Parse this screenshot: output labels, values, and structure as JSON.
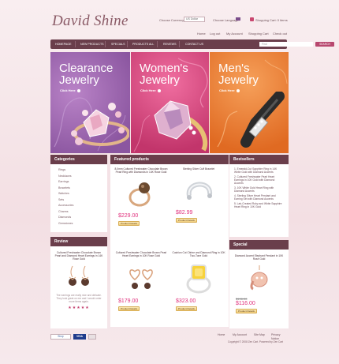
{
  "brand": {
    "logo": "David Shine"
  },
  "header": {
    "currency_label": "Choose Currency:",
    "currency_value": "US Dollar",
    "language_label": "Choose Language:",
    "cart_label": "Shopping Cart: 0 items",
    "links": [
      "Home",
      "Log out",
      "My Account",
      "Shopping Cart",
      "Check out"
    ]
  },
  "nav": {
    "items": [
      "HOMEPAGE",
      "NEW PRODUCTS",
      "SPECIALS",
      "PRODUCTS ALL",
      "REVIEWS",
      "CONTACT US"
    ],
    "search_placeholder": "Find",
    "search_button": "SEARCH"
  },
  "banners": [
    {
      "line1": "Clearance",
      "line2": "Jewelry",
      "more": "Click Here"
    },
    {
      "line1": "Women's",
      "line2": "Jewelry",
      "more": "Click Here"
    },
    {
      "line1": "Men's",
      "line2": "Jewelry",
      "more": "Click Here"
    }
  ],
  "categories": {
    "title": "Categories",
    "items": [
      "Rings",
      "Necklaces",
      "Earrings",
      "Bracelets",
      "Watches",
      "Sets",
      "Accessories",
      "Charms",
      "Diamonds",
      "Gemstones"
    ]
  },
  "review": {
    "title": "Review",
    "product": "Cultured Freshwater Chocolate Brown Pearl and Diamond Heart Earrings in 14K Rose Gold",
    "text": "The earrings are really nice and delicate. They look great on me and I would order more items again."
  },
  "featured": {
    "title": "Featured products",
    "products": [
      {
        "name": "8.0mm Cultured Freshwater Chocolate Brown Pearl Ring with Diamonds in 14K Rose Gold",
        "price": "$229.00",
        "button": "Product Details"
      },
      {
        "name": "Sterling Silver Cuff Bracelet",
        "price": "$82.99",
        "button": "Product Details"
      },
      {
        "name": "Cultured Freshwater Chocolate Brown Pearl Heart Earrings in 10K Rose Gold",
        "price": "$179.00",
        "button": "Product Details"
      },
      {
        "name": "Cushion Cut Citrine and Diamond Ring in 10K Two-Tone Gold",
        "price": "$323.00",
        "button": "Product Details"
      }
    ]
  },
  "bestsellers": {
    "title": "Bestsellers",
    "items": [
      "1. Emerald-Cut Sapphire Ring in 14K White Gold with Diamond Accents",
      "2. Cultured Freshwater Pearl Heart Earrings in 10K Gold with Diamond Accents",
      "3. 10K White Gold Heart Ring with Diamond Accents",
      "4. Sterling Silver Heart Pendant and Earring Set with Diamond Accents",
      "5. Lab-Created Ruby and White Sapphire Heart Ring in 10K Gold"
    ]
  },
  "special": {
    "title": "Special",
    "name": "Diamond Accent Elephant Pendant in 10K Rose Gold",
    "old_price": "$196.00",
    "price": "$116.00",
    "button": "Product Details"
  },
  "footer": {
    "links": [
      "Home",
      "My Account",
      "Site Map",
      "Privacy Notice"
    ],
    "copyright": "Copyright © 2008 Zen Cart. Powered by Zen Cart",
    "badge1": "Shop",
    "badge2": "VISA"
  }
}
